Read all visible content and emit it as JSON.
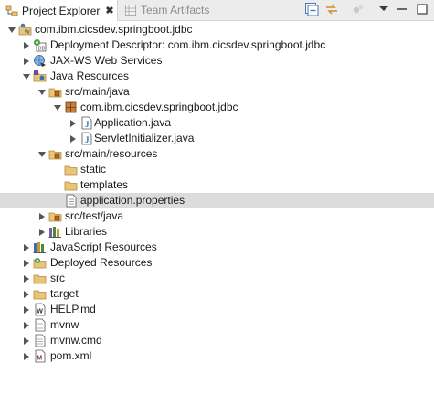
{
  "tabs": {
    "active_label": "Project Explorer",
    "close_glyph": "✖",
    "inactive_label": "Team Artifacts"
  },
  "colors": {
    "folder": "#e8c57a",
    "folder_stroke": "#b8893a",
    "package": "#b5651d",
    "java_file": "#3a6fb0",
    "selection": "#dcdcdc"
  },
  "tree": {
    "root_label": "com.ibm.cicsdev.springboot.jdbc",
    "deployment_descriptor": "Deployment Descriptor: com.ibm.cicsdev.springboot.jdbc",
    "jaxws": "JAX-WS Web Services",
    "java_resources": "Java Resources",
    "src_main_java": "src/main/java",
    "package": "com.ibm.cicsdev.springboot.jdbc",
    "application_java": "Application.java",
    "servlet_initializer": "ServletInitializer.java",
    "src_main_resources": "src/main/resources",
    "static": "static",
    "templates": "templates",
    "application_properties": "application.properties",
    "src_test_java": "src/test/java",
    "libraries": "Libraries",
    "javascript_resources": "JavaScript Resources",
    "deployed_resources": "Deployed Resources",
    "src": "src",
    "target": "target",
    "help_md": "HELP.md",
    "mvnw": "mvnw",
    "mvnw_cmd": "mvnw.cmd",
    "pom_xml": "pom.xml"
  }
}
